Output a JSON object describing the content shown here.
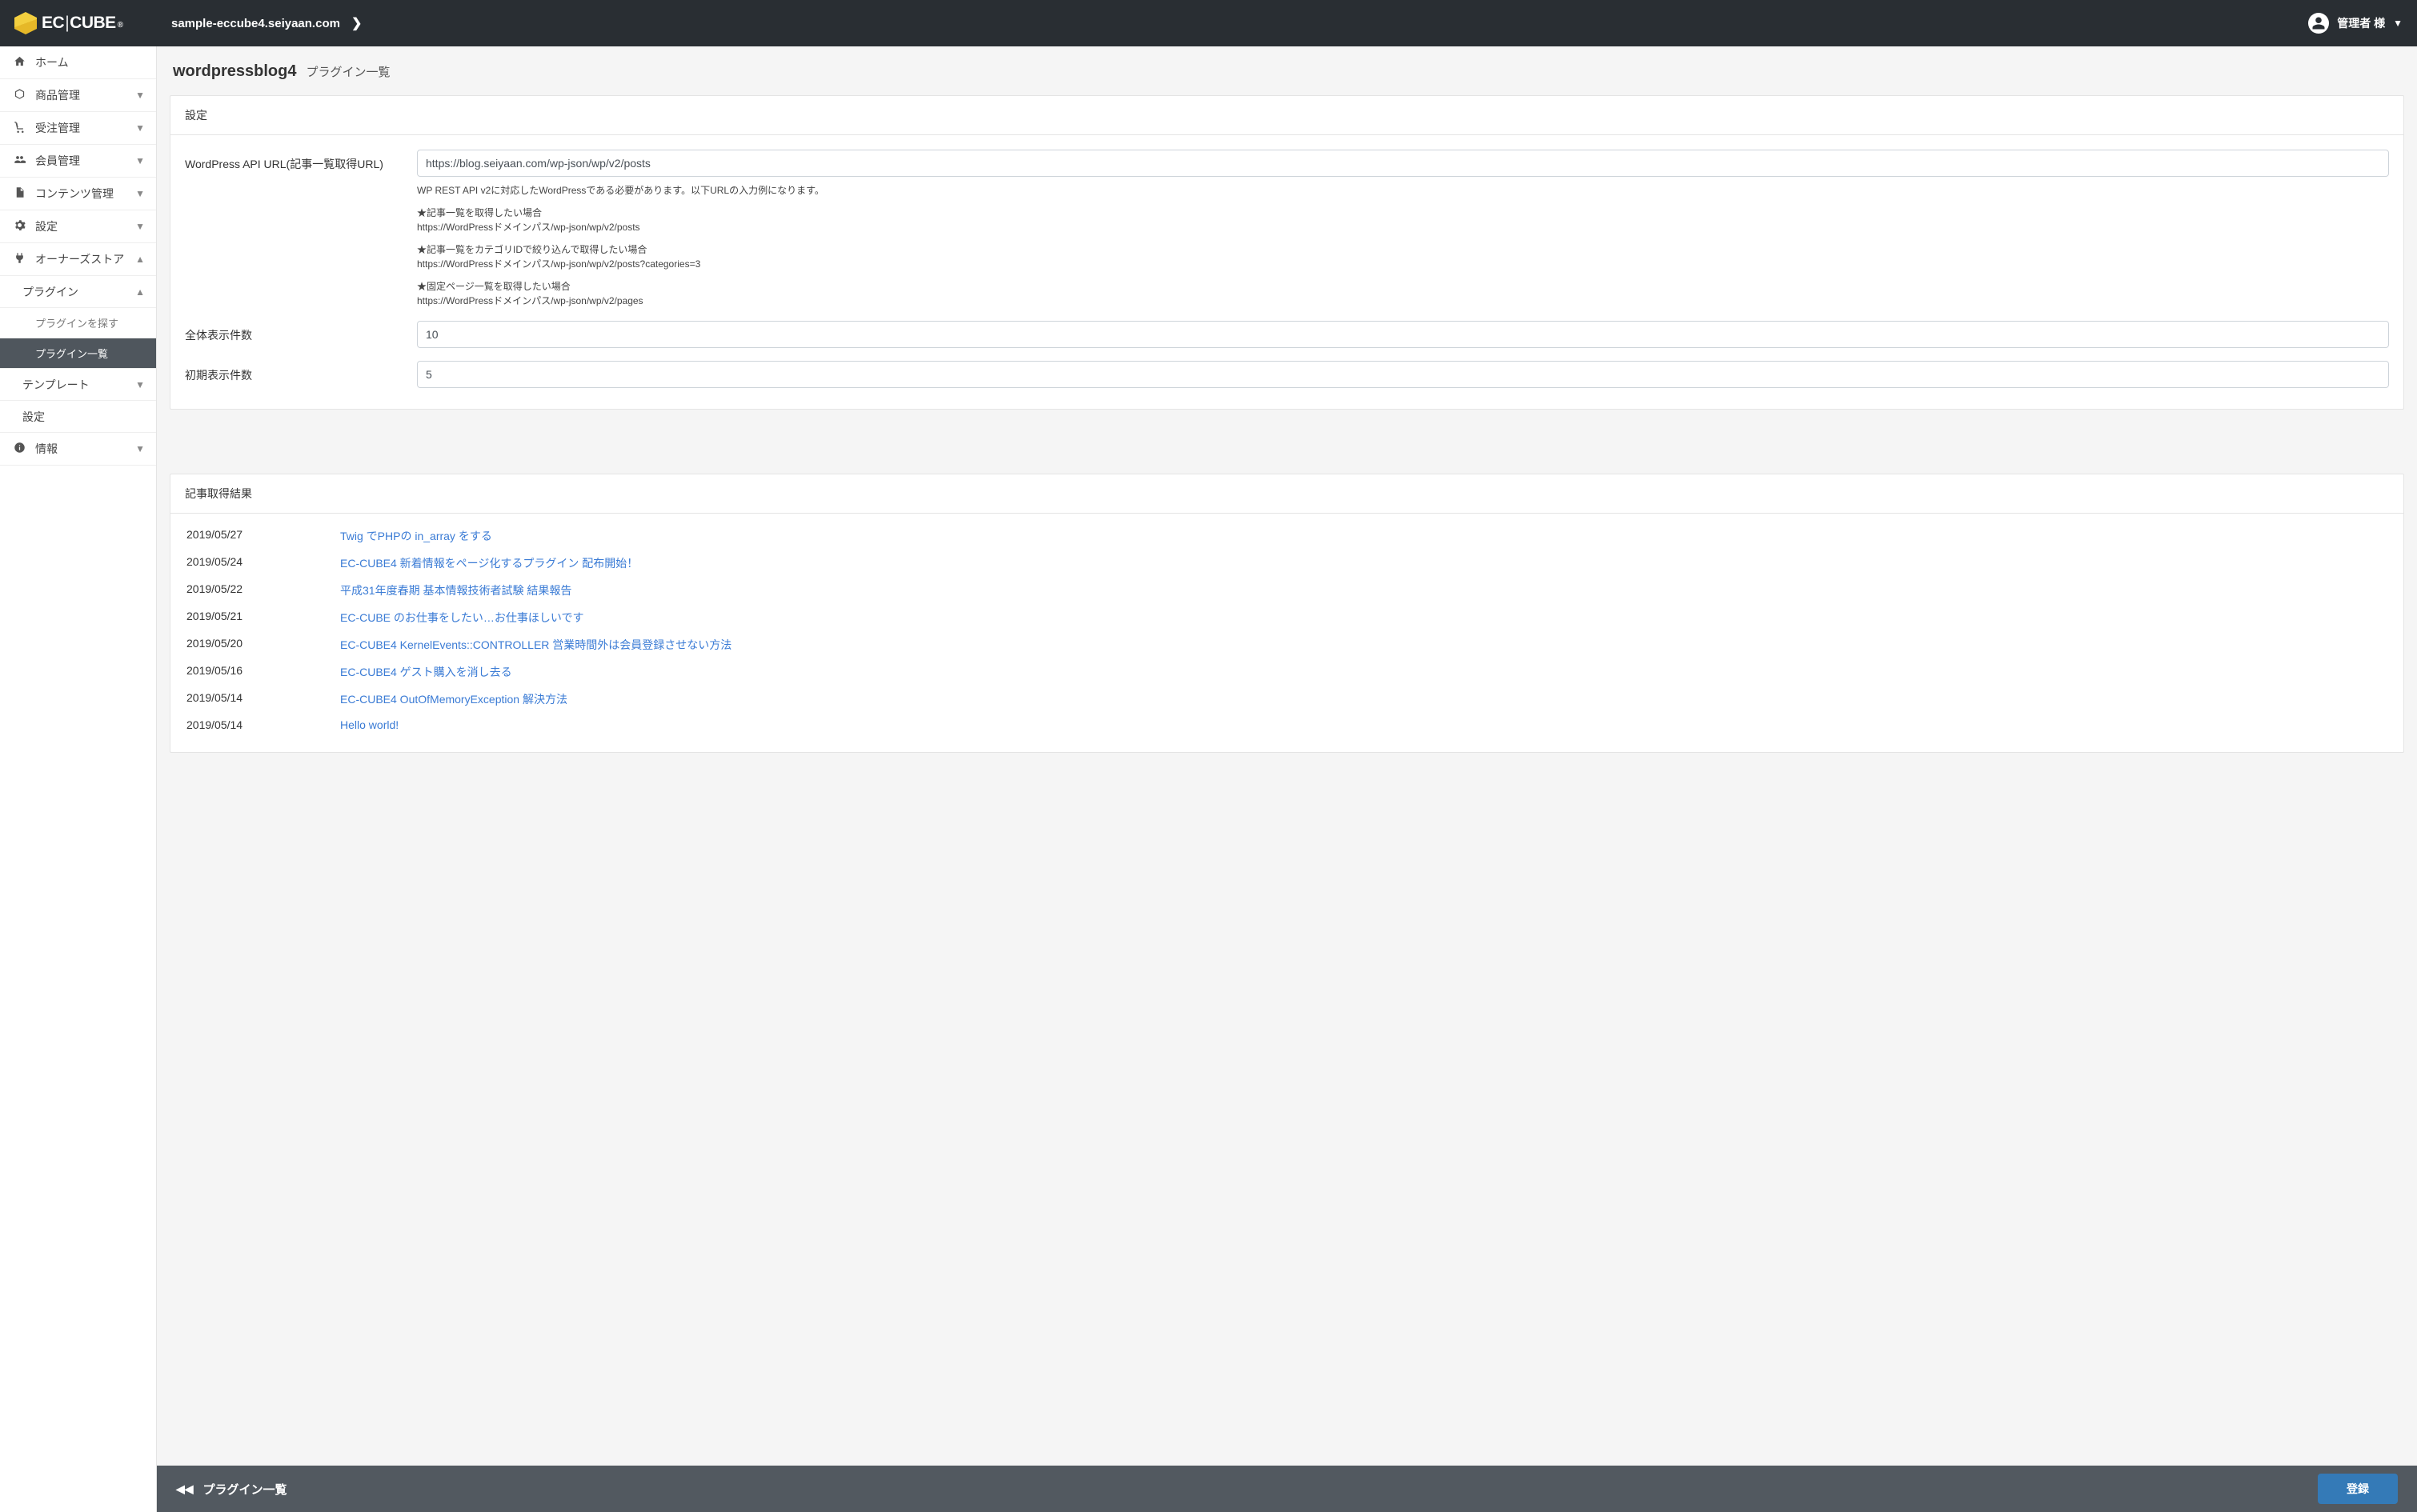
{
  "header": {
    "logo_text_left": "EC",
    "logo_text_right": "CUBE",
    "breadcrumb": "sample-eccube4.seiyaan.com",
    "user_label": "管理者 様"
  },
  "sidebar": {
    "items": [
      {
        "key": "home",
        "label": "ホーム",
        "icon": "home",
        "expandable": false
      },
      {
        "key": "product",
        "label": "商品管理",
        "icon": "cube",
        "expandable": true
      },
      {
        "key": "order",
        "label": "受注管理",
        "icon": "cart",
        "expandable": true
      },
      {
        "key": "member",
        "label": "会員管理",
        "icon": "users",
        "expandable": true
      },
      {
        "key": "content",
        "label": "コンテンツ管理",
        "icon": "file",
        "expandable": true
      },
      {
        "key": "setting",
        "label": "設定",
        "icon": "gear",
        "expandable": true
      },
      {
        "key": "store",
        "label": "オーナーズストア",
        "icon": "plug",
        "expandable": true,
        "expanded": true
      },
      {
        "key": "info",
        "label": "情報",
        "icon": "info",
        "expandable": true
      }
    ],
    "store_children": [
      {
        "key": "plugin",
        "label": "プラグイン",
        "expandable": true,
        "expanded": true
      },
      {
        "key": "template",
        "label": "テンプレート",
        "expandable": true,
        "expanded": false
      },
      {
        "key": "ssetting",
        "label": "設定",
        "expandable": false
      }
    ],
    "plugin_children": [
      {
        "key": "plugin-search",
        "label": "プラグインを探す",
        "active": false
      },
      {
        "key": "plugin-list",
        "label": "プラグイン一覧",
        "active": true
      }
    ]
  },
  "page": {
    "title": "wordpressblog4",
    "subtitle": "プラグイン一覧"
  },
  "settings_card": {
    "header": "設定",
    "rows": [
      {
        "label": "WordPress API URL(記事一覧取得URL)",
        "input_value": "https://blog.seiyaan.com/wp-json/wp/v2/posts",
        "help_intro": "WP REST API v2に対応したWordPressである必要があります。以下URLの入力例になります。",
        "help_items": [
          {
            "h": "★記事一覧を取得したい場合",
            "u": "https://WordPressドメインパス/wp-json/wp/v2/posts"
          },
          {
            "h": "★記事一覧をカテゴリIDで絞り込んで取得したい場合",
            "u": "https://WordPressドメインパス/wp-json/wp/v2/posts?categories=3"
          },
          {
            "h": "★固定ページ一覧を取得したい場合",
            "u": "https://WordPressドメインパス/wp-json/wp/v2/pages"
          }
        ]
      },
      {
        "label": "全体表示件数",
        "input_value": "10"
      },
      {
        "label": "初期表示件数",
        "input_value": "5"
      }
    ]
  },
  "results_card": {
    "header": "記事取得結果",
    "rows": [
      {
        "date": "2019/05/27",
        "title": "Twig でPHPの in_array をする"
      },
      {
        "date": "2019/05/24",
        "title": "EC-CUBE4 新着情報をページ化するプラグイン 配布開始！"
      },
      {
        "date": "2019/05/22",
        "title": "平成31年度春期 基本情報技術者試験 結果報告"
      },
      {
        "date": "2019/05/21",
        "title": "EC-CUBE のお仕事をしたい…お仕事ほしいです"
      },
      {
        "date": "2019/05/20",
        "title": "EC-CUBE4 KernelEvents::CONTROLLER 営業時間外は会員登録させない方法"
      },
      {
        "date": "2019/05/16",
        "title": "EC-CUBE4 ゲスト購入を消し去る"
      },
      {
        "date": "2019/05/14",
        "title": "EC-CUBE4 OutOfMemoryException 解決方法"
      },
      {
        "date": "2019/05/14",
        "title": "Hello world!"
      }
    ]
  },
  "footer": {
    "back_label": "プラグイン一覧",
    "submit_label": "登録"
  }
}
